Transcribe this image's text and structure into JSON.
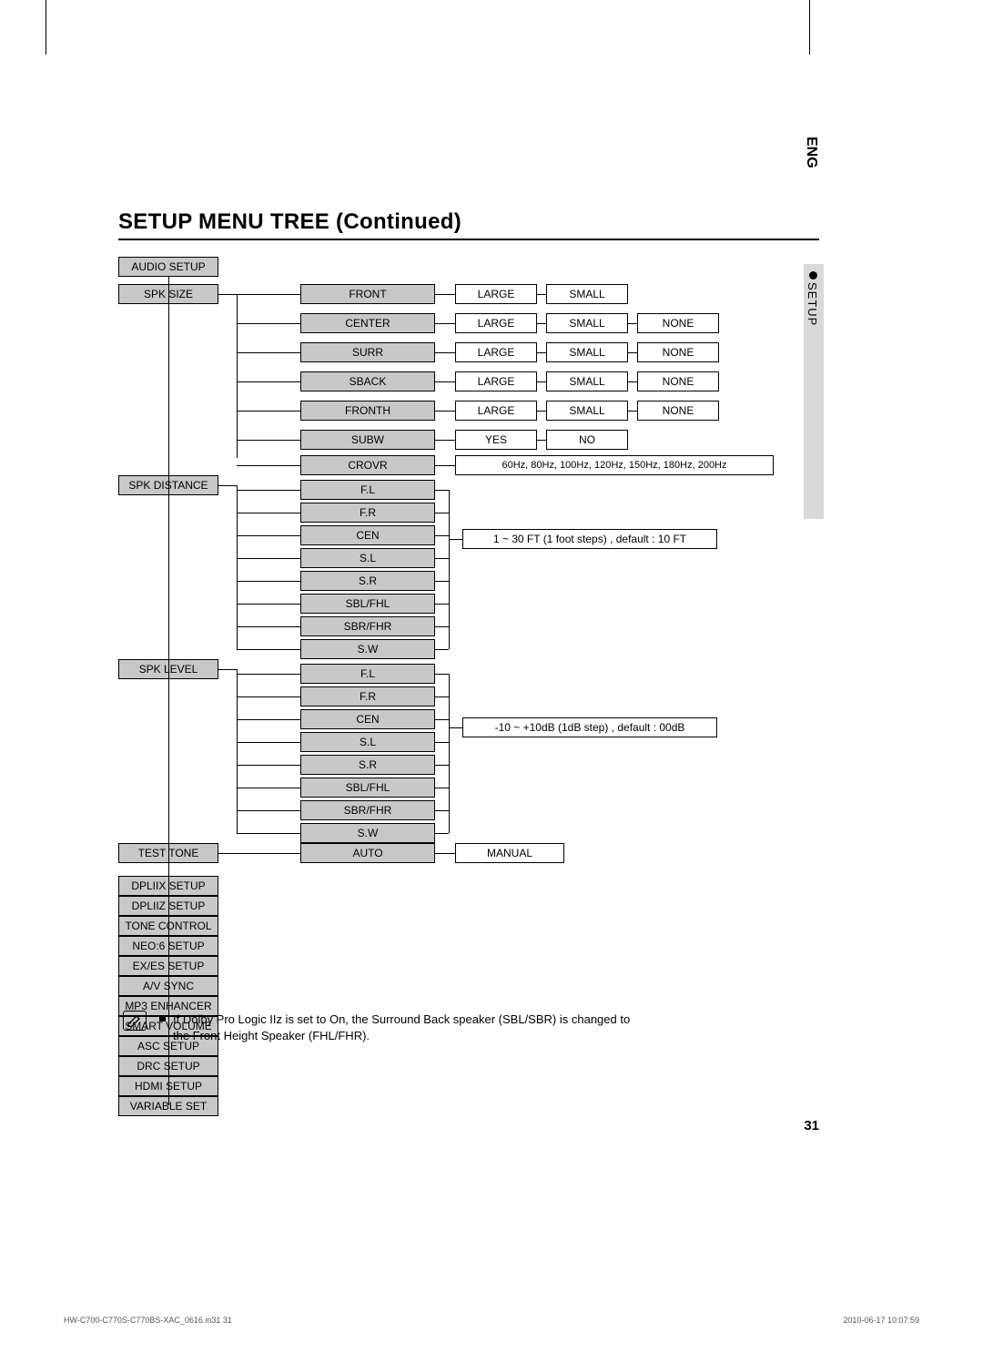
{
  "lang": "ENG",
  "section": "SETUP",
  "title": "SETUP MENU TREE (Continued)",
  "menu": {
    "root": "AUDIO SETUP",
    "spk_size": {
      "label": "SPK SIZE",
      "items": {
        "front": {
          "label": "FRONT",
          "opts": [
            "LARGE",
            "SMALL"
          ]
        },
        "center": {
          "label": "CENTER",
          "opts": [
            "LARGE",
            "SMALL",
            "NONE"
          ]
        },
        "surr": {
          "label": "SURR",
          "opts": [
            "LARGE",
            "SMALL",
            "NONE"
          ]
        },
        "sback": {
          "label": "SBACK",
          "opts": [
            "LARGE",
            "SMALL",
            "NONE"
          ]
        },
        "fronth": {
          "label": "FRONTH",
          "opts": [
            "LARGE",
            "SMALL",
            "NONE"
          ]
        },
        "subw": {
          "label": "SUBW",
          "opts": [
            "YES",
            "NO"
          ]
        },
        "crovr": {
          "label": "CROVR",
          "text": "60Hz, 80Hz, 100Hz, 120Hz, 150Hz, 180Hz, 200Hz"
        }
      }
    },
    "spk_distance": {
      "label": "SPK DISTANCE",
      "items": [
        "F.L",
        "F.R",
        "CEN",
        "S.L",
        "S.R",
        "SBL/FHL",
        "SBR/FHR",
        "S.W"
      ],
      "value": "1 ~ 30 FT (1 foot steps) , default : 10 FT"
    },
    "spk_level": {
      "label": "SPK LEVEL",
      "items": [
        "F.L",
        "F.R",
        "CEN",
        "S.L",
        "S.R",
        "SBL/FHL",
        "SBR/FHR",
        "S.W"
      ],
      "value": "-10 ~ +10dB (1dB step) , default : 00dB"
    },
    "test_tone": {
      "label": "TEST TONE",
      "opts": [
        "AUTO",
        "MANUAL"
      ]
    },
    "rest": [
      "DPLIIX SETUP",
      "DPLIIZ SETUP",
      "TONE CONTROL",
      "NEO:6 SETUP",
      "EX/ES SETUP",
      "A/V SYNC",
      "MP3 ENHANCER",
      "SMART VOLUME",
      "ASC SETUP",
      "DRC SETUP",
      "HDMI SETUP",
      "VARIABLE SET"
    ]
  },
  "note": "If Dolby Pro Logic IIz is set to On, the Surround Back speaker (SBL/SBR) is changed to the Front Height Speaker (FHL/FHR).",
  "page_num": "31",
  "footer_left": "HW-C700-C770S-C770BS-XAC_0616.in31   31",
  "footer_right": "2010-06-17      10:07:59"
}
